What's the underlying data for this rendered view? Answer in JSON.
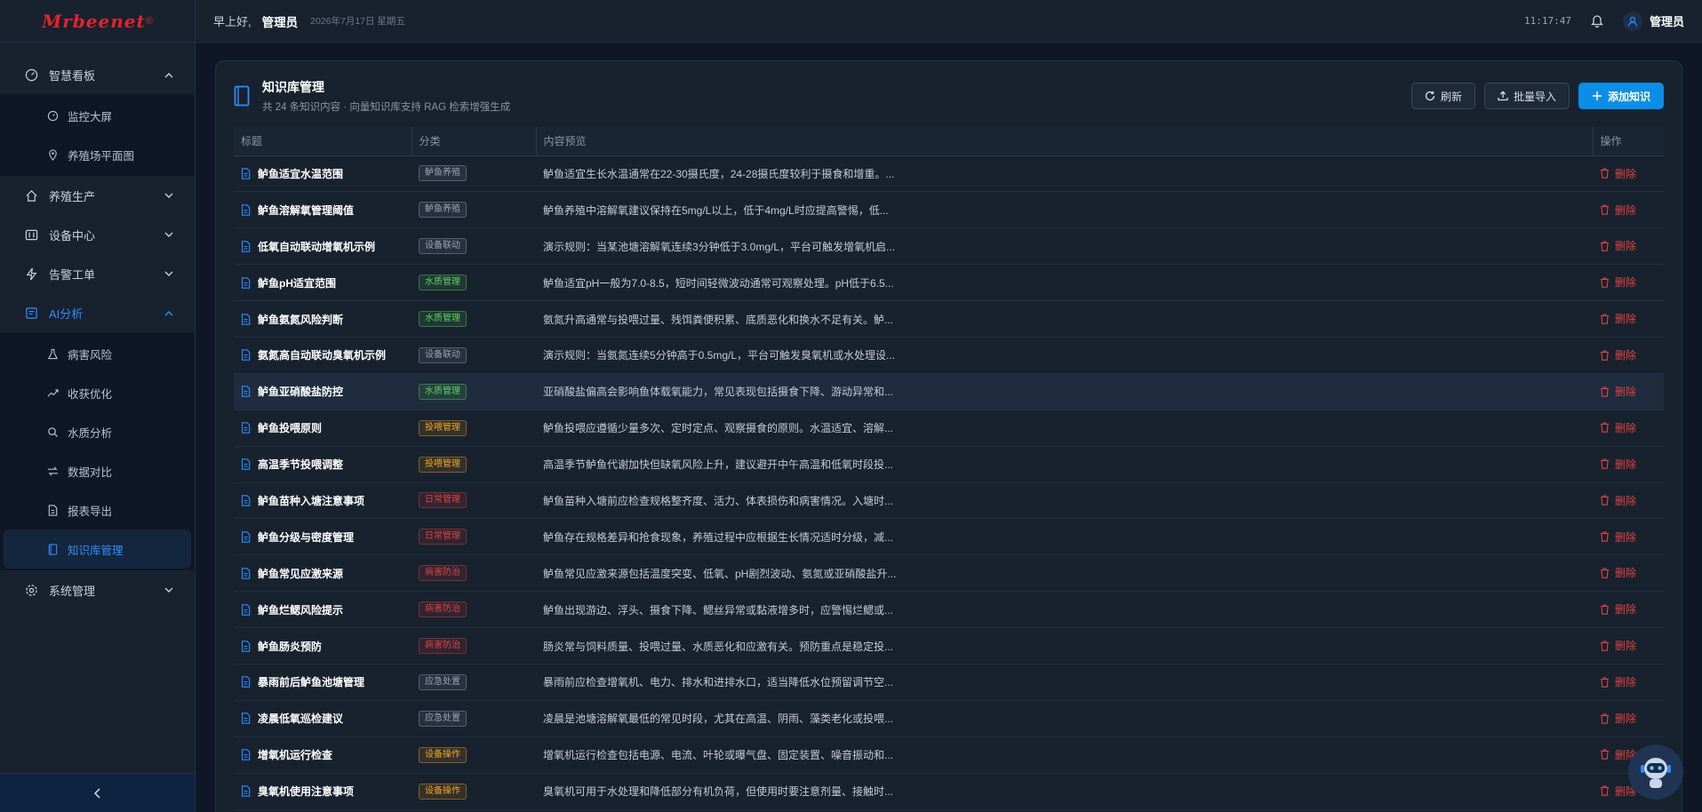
{
  "brand": {
    "name": "Mrbeenet",
    "mark": "®"
  },
  "topbar": {
    "greeting": "早上好,",
    "user": "管理员",
    "date": "2026年7月17日 星期五",
    "time": "11:17:47",
    "account": "管理员"
  },
  "sidebar": {
    "groups": [
      {
        "label": "智慧看板",
        "icon": "gauge-icon",
        "expanded": true,
        "items": [
          {
            "label": "监控大屏",
            "icon": "dashboard-icon"
          },
          {
            "label": "养殖场平面图",
            "icon": "map-pin-icon"
          }
        ]
      },
      {
        "label": "养殖生产",
        "icon": "home-icon",
        "expanded": false
      },
      {
        "label": "设备中心",
        "icon": "sliders-icon",
        "expanded": false
      },
      {
        "label": "告警工单",
        "icon": "lightning-icon",
        "expanded": false
      },
      {
        "label": "AI分析",
        "icon": "ai-icon",
        "expanded": true,
        "active": true,
        "items": [
          {
            "label": "病害风险",
            "icon": "flask-icon"
          },
          {
            "label": "收获优化",
            "icon": "trend-icon"
          },
          {
            "label": "水质分析",
            "icon": "search-icon"
          },
          {
            "label": "数据对比",
            "icon": "swap-icon"
          },
          {
            "label": "报表导出",
            "icon": "report-icon"
          },
          {
            "label": "知识库管理",
            "icon": "book-icon",
            "selected": true
          }
        ]
      },
      {
        "label": "系统管理",
        "icon": "gear-icon",
        "expanded": false
      }
    ]
  },
  "page": {
    "title": "知识库管理",
    "subtitle": "共 24 条知识内容 · 向量知识库支持 RAG 检索增强生成",
    "buttons": {
      "refresh": "刷新",
      "import": "批量导入",
      "add": "添加知识"
    }
  },
  "table": {
    "columns": [
      "标题",
      "分类",
      "内容预览",
      "操作"
    ],
    "delete_label": "删除",
    "tag_colors": {
      "鲈鱼养殖": "#9aa4b2",
      "设备联动": "#9aa4b2",
      "水质管理": "#5fd35f",
      "投喂管理": "#f5a623",
      "日常管理": "#e0413f",
      "病害防治": "#e0413f",
      "应急处置": "#9aa4b2",
      "设备操作": "#f5a623"
    },
    "rows": [
      {
        "title": "鲈鱼适宜水温范围",
        "tag": "鲈鱼养殖",
        "preview": "鲈鱼适宜生长水温通常在22-30摄氏度，24-28摄氏度较利于摄食和增重。..."
      },
      {
        "title": "鲈鱼溶解氧管理阈值",
        "tag": "鲈鱼养殖",
        "preview": "鲈鱼养殖中溶解氧建议保持在5mg/L以上，低于4mg/L时应提高警惕，低..."
      },
      {
        "title": "低氧自动联动增氧机示例",
        "tag": "设备联动",
        "preview": "演示规则：当某池塘溶解氧连续3分钟低于3.0mg/L，平台可触发增氧机启..."
      },
      {
        "title": "鲈鱼pH适宜范围",
        "tag": "水质管理",
        "preview": "鲈鱼适宜pH一般为7.0-8.5，短时间轻微波动通常可观察处理。pH低于6.5..."
      },
      {
        "title": "鲈鱼氨氮风险判断",
        "tag": "水质管理",
        "preview": "氨氮升高通常与投喂过量、残饵粪便积累、底质恶化和换水不足有关。鲈..."
      },
      {
        "title": "氨氮高自动联动臭氧机示例",
        "tag": "设备联动",
        "preview": "演示规则：当氨氮连续5分钟高于0.5mg/L，平台可触发臭氧机或水处理设..."
      },
      {
        "title": "鲈鱼亚硝酸盐防控",
        "tag": "水质管理",
        "preview": "亚硝酸盐偏高会影响鱼体载氧能力，常见表现包括摄食下降、游动异常和...",
        "highlight": true
      },
      {
        "title": "鲈鱼投喂原则",
        "tag": "投喂管理",
        "preview": "鲈鱼投喂应遵循少量多次、定时定点、观察摄食的原则。水温适宜、溶解..."
      },
      {
        "title": "高温季节投喂调整",
        "tag": "投喂管理",
        "preview": "高温季节鲈鱼代谢加快但缺氧风险上升，建议避开中午高温和低氧时段投..."
      },
      {
        "title": "鲈鱼苗种入塘注意事项",
        "tag": "日常管理",
        "preview": "鲈鱼苗种入塘前应检查规格整齐度、活力、体表损伤和病害情况。入塘时..."
      },
      {
        "title": "鲈鱼分级与密度管理",
        "tag": "日常管理",
        "preview": "鲈鱼存在规格差异和抢食现象，养殖过程中应根据生长情况适时分级，减..."
      },
      {
        "title": "鲈鱼常见应激来源",
        "tag": "病害防治",
        "preview": "鲈鱼常见应激来源包括温度突变、低氧、pH剧烈波动、氨氮或亚硝酸盐升..."
      },
      {
        "title": "鲈鱼烂鳃风险提示",
        "tag": "病害防治",
        "preview": "鲈鱼出现游边、浮头、摄食下降、鳃丝异常或黏液增多时，应警惕烂鳃或..."
      },
      {
        "title": "鲈鱼肠炎预防",
        "tag": "病害防治",
        "preview": "肠炎常与饲料质量、投喂过量、水质恶化和应激有关。预防重点是稳定投..."
      },
      {
        "title": "暴雨前后鲈鱼池塘管理",
        "tag": "应急处置",
        "preview": "暴雨前应检查增氧机、电力、排水和进排水口，适当降低水位预留调节空..."
      },
      {
        "title": "凌晨低氧巡检建议",
        "tag": "应急处置",
        "preview": "凌晨是池塘溶解氧最低的常见时段，尤其在高温、阴雨、藻类老化或投喂..."
      },
      {
        "title": "增氧机运行检查",
        "tag": "设备操作",
        "preview": "增氧机运行检查包括电源、电流、叶轮或曝气盘、固定装置、噪音振动和..."
      },
      {
        "title": "臭氧机使用注意事项",
        "tag": "设备操作",
        "preview": "臭氧机可用于水处理和降低部分有机负荷，但使用时要注意剂量、接触时..."
      }
    ]
  }
}
